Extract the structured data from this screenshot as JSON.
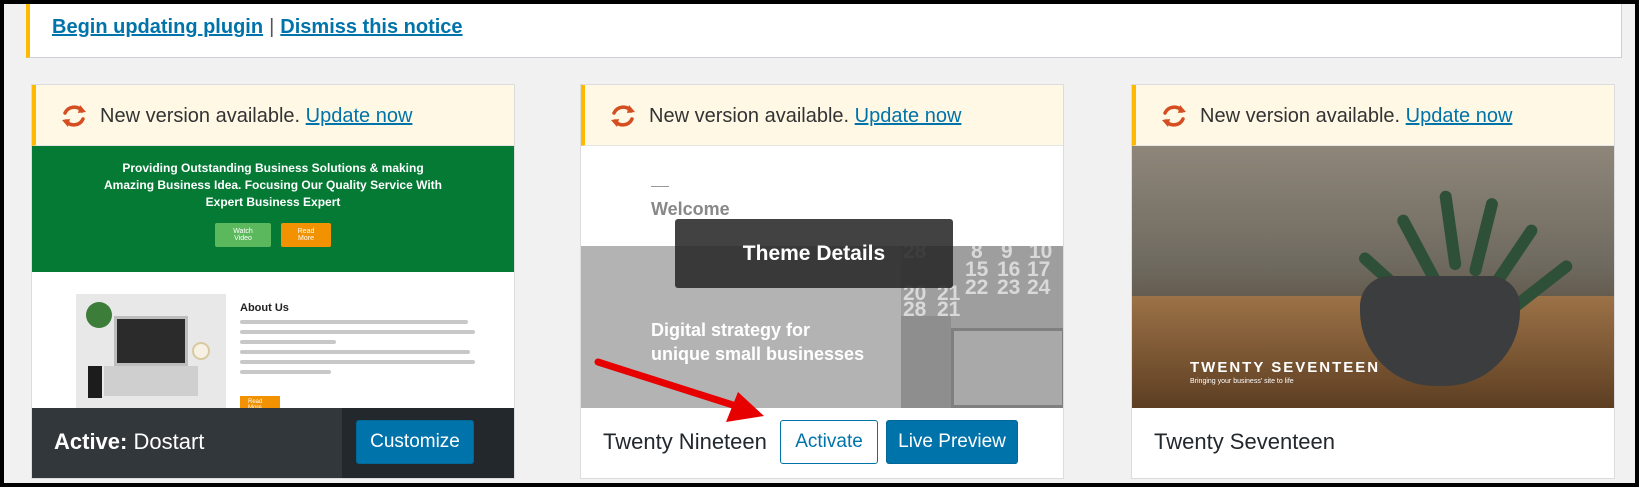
{
  "notice": {
    "link_update": "Begin updating plugin",
    "separator": "|",
    "link_dismiss": "Dismiss this notice"
  },
  "themes": [
    {
      "update_text": "New version available.",
      "update_link": "Update now",
      "active_label": "Active:",
      "name": "Dostart",
      "customize": "Customize",
      "screenshot": {
        "headline": "Providing Outstanding Business Solutions & making Amazing Business Idea. Focusing Our Quality Service With Expert Business Expert",
        "watch": "Watch Video",
        "read": "Read More",
        "about": "About Us",
        "about_btn": "Read More"
      }
    },
    {
      "update_text": "New version available.",
      "update_link": "Update now",
      "name": "Twenty Nineteen",
      "activate": "Activate",
      "live_preview": "Live Preview",
      "details": "Theme Details",
      "screenshot": {
        "welcome": "Welcome",
        "strategy_1": "Digital strategy for",
        "strategy_2": "unique small businesses",
        "calendar": [
          "8",
          "9",
          "10",
          "15",
          "16",
          "17",
          "22",
          "23",
          "24",
          "20",
          "21",
          "28",
          "21",
          "28"
        ]
      }
    },
    {
      "update_text": "New version available.",
      "update_link": "Update now",
      "name": "Twenty Seventeen",
      "screenshot": {
        "title": "TWENTY SEVENTEEN",
        "tagline": "Bringing your business' site to life"
      }
    }
  ],
  "colors": {
    "accent": "#0073aa",
    "warning": "#ffb900",
    "update_icon": "#d54e21",
    "arrow": "#e60000"
  }
}
